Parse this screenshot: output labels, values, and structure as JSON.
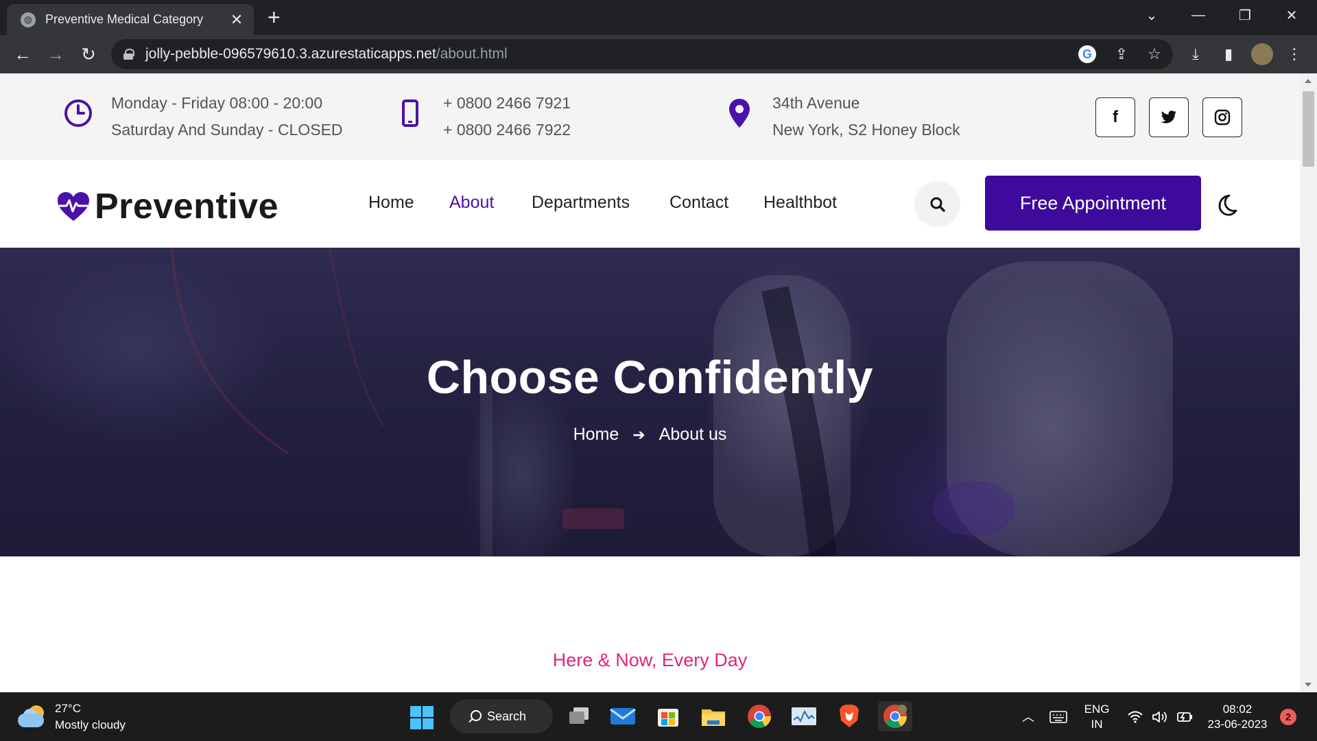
{
  "browser": {
    "tab_title": "Preventive Medical Category",
    "url_host": "jolly-pebble-096579610.3.azurestaticapps.net",
    "url_path": "/about.html"
  },
  "topbar": {
    "hours_line1": "Monday - Friday 08:00 - 20:00",
    "hours_line2": "Saturday And Sunday - CLOSED",
    "phone_line1": "+ 0800 2466 7921",
    "phone_line2": "+ 0800 2466 7922",
    "address_line1": "34th Avenue",
    "address_line2": "New York, S2 Honey Block",
    "social": {
      "facebook": "f",
      "twitter": "twitter-icon",
      "instagram": "instagram-icon"
    }
  },
  "nav": {
    "logo": "Preventive",
    "links": [
      "Home",
      "About",
      "Departments",
      "Contact",
      "Healthbot"
    ],
    "active": "About",
    "cta": "Free Appointment"
  },
  "hero": {
    "title": "Choose Confidently",
    "breadcrumb_home": "Home",
    "breadcrumb_current": "About us"
  },
  "section": {
    "tagline": "Here & Now, Every Day"
  },
  "taskbar": {
    "temperature": "27°C",
    "weather": "Mostly cloudy",
    "search": "Search",
    "lang1": "ENG",
    "lang2": "IN",
    "time": "08:02",
    "date": "23-06-2023",
    "notifications": "2"
  },
  "colors": {
    "brand": "#3d0a9c",
    "accent_pink": "#e0247a",
    "icon_purple": "#4a12a8"
  }
}
